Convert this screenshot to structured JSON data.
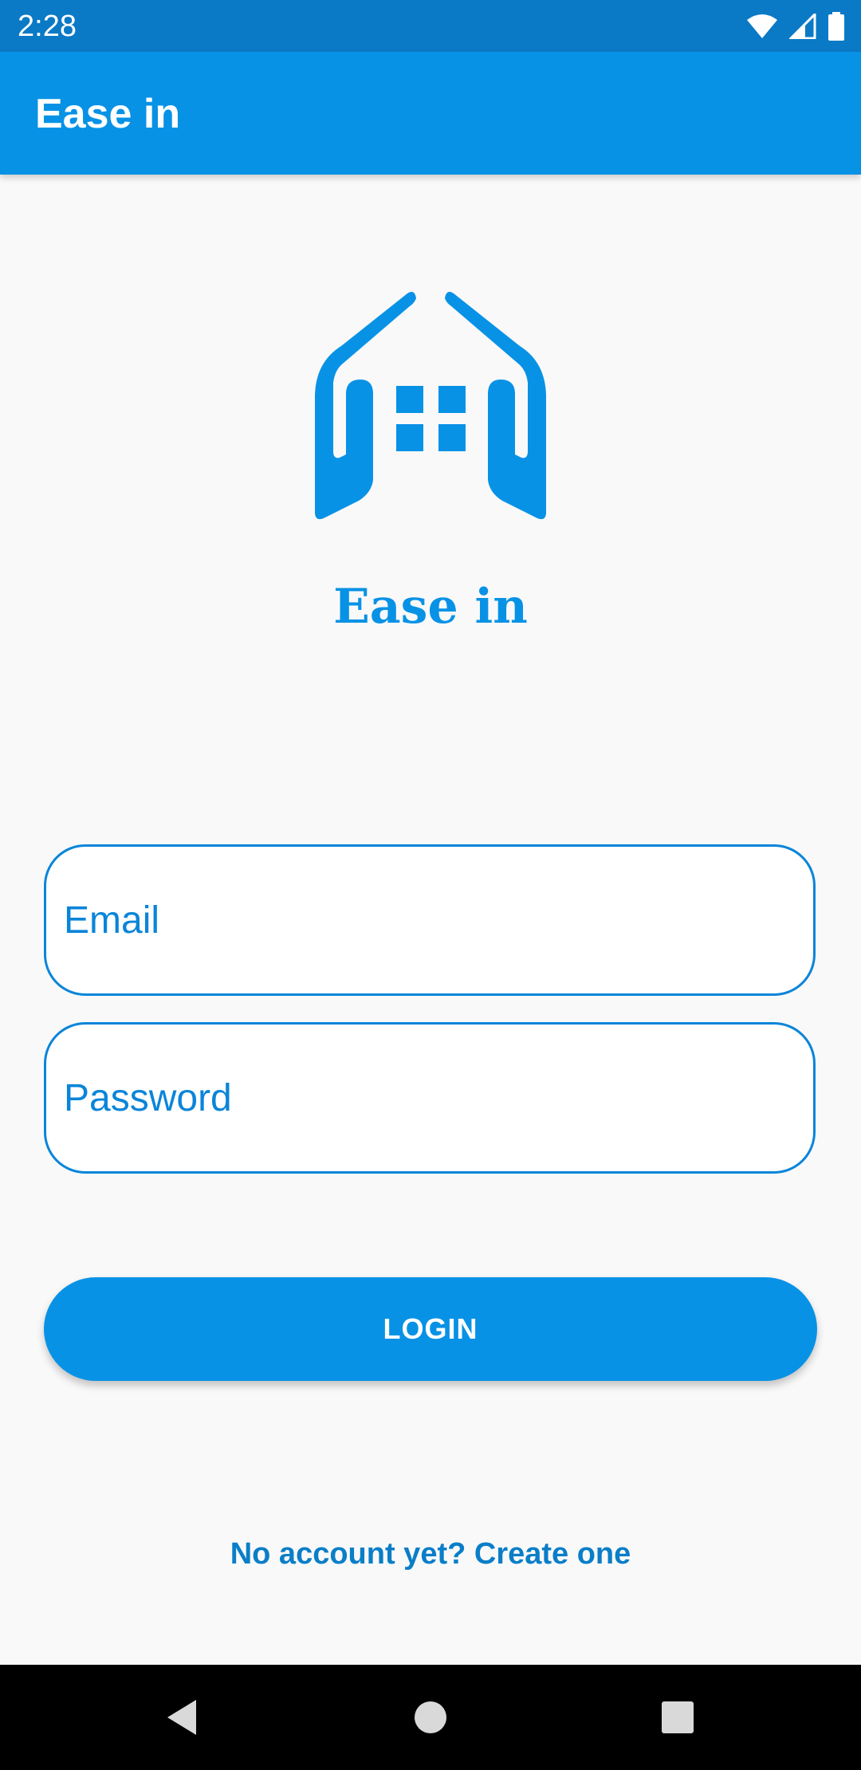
{
  "status_bar": {
    "time": "2:28",
    "icons": [
      "wifi-icon",
      "signal-icon",
      "battery-icon"
    ]
  },
  "app_bar": {
    "title": "Ease in"
  },
  "logo": {
    "icon": "house-logo-icon",
    "title": "Ease in"
  },
  "form": {
    "email": {
      "placeholder": "Email",
      "value": ""
    },
    "password": {
      "placeholder": "Password",
      "value": ""
    },
    "login_label": "LOGIN",
    "signup_link": "No account yet? Create one"
  },
  "nav_bar": {
    "icons": [
      "back-icon",
      "home-icon",
      "recents-icon"
    ]
  },
  "colors": {
    "status_bar": "#0a79c6",
    "app_bar": "#0892e6",
    "accent": "#0892e6",
    "field_border": "#0a85d9",
    "background": "#f9f9f9"
  }
}
